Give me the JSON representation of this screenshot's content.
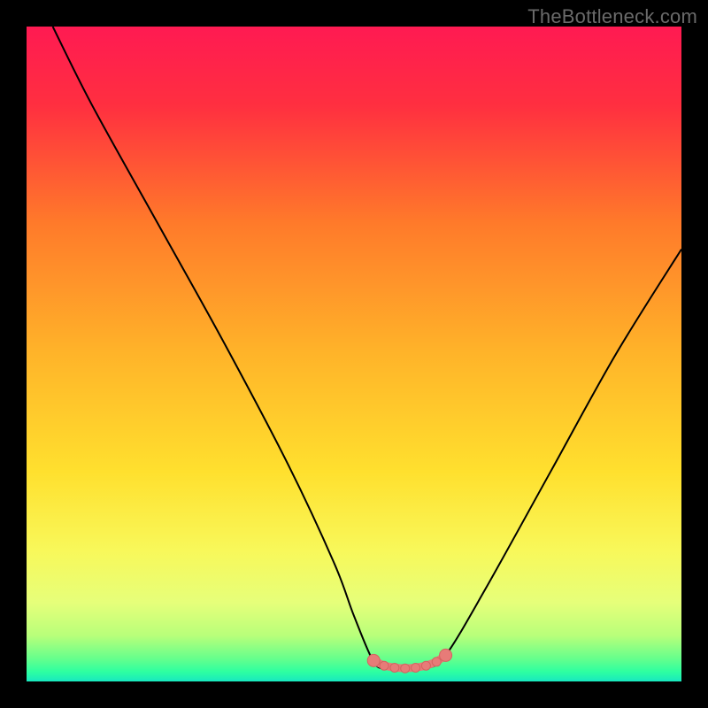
{
  "watermark": "TheBottleneck.com",
  "colors": {
    "frame": "#000000",
    "gradient_stops": [
      {
        "offset": 0.0,
        "color": "#ff1a52"
      },
      {
        "offset": 0.12,
        "color": "#ff2f40"
      },
      {
        "offset": 0.3,
        "color": "#ff7a2a"
      },
      {
        "offset": 0.5,
        "color": "#ffb429"
      },
      {
        "offset": 0.68,
        "color": "#ffe02e"
      },
      {
        "offset": 0.8,
        "color": "#f8f85a"
      },
      {
        "offset": 0.88,
        "color": "#e6ff7a"
      },
      {
        "offset": 0.93,
        "color": "#b8ff7a"
      },
      {
        "offset": 0.965,
        "color": "#66ff8c"
      },
      {
        "offset": 0.985,
        "color": "#2effa0"
      },
      {
        "offset": 1.0,
        "color": "#18e8c0"
      }
    ],
    "curve": "#000000",
    "marker_fill": "#e77b78",
    "marker_stroke": "#d46360"
  },
  "chart_data": {
    "type": "line",
    "title": "",
    "xlabel": "",
    "ylabel": "",
    "xlim": [
      0,
      100
    ],
    "ylim": [
      0,
      100
    ],
    "series": [
      {
        "name": "bottleneck-curve",
        "x": [
          4,
          10,
          20,
          30,
          40,
          47,
          50,
          53,
          55,
          58,
          61,
          64,
          70,
          80,
          90,
          100
        ],
        "values": [
          100,
          88,
          70,
          52,
          33,
          18,
          10,
          3,
          2,
          2,
          2,
          4,
          14,
          32,
          50,
          66
        ]
      }
    ],
    "markers": {
      "name": "optimal-range",
      "points": [
        {
          "x": 53.0,
          "y": 3.2,
          "r": 7
        },
        {
          "x": 54.6,
          "y": 2.4,
          "r": 5
        },
        {
          "x": 56.2,
          "y": 2.1,
          "r": 5
        },
        {
          "x": 57.8,
          "y": 2.0,
          "r": 5
        },
        {
          "x": 59.4,
          "y": 2.1,
          "r": 5
        },
        {
          "x": 61.0,
          "y": 2.4,
          "r": 5
        },
        {
          "x": 62.6,
          "y": 3.0,
          "r": 5
        },
        {
          "x": 64.0,
          "y": 4.0,
          "r": 7
        }
      ]
    }
  }
}
